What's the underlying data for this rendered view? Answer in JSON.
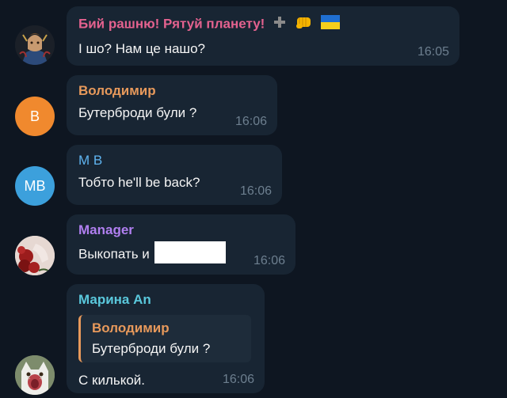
{
  "messages": [
    {
      "sender": "Бий рашню! Рятуй планету!",
      "sender_color": "#e4628f",
      "text": "І шо? Нам це нашо?",
      "time": "16:05",
      "avatar_icon": "warrior-portrait-avatar"
    },
    {
      "sender": "Володимир",
      "sender_color": "#e7995b",
      "text": "Бутерброди були ?",
      "time": "16:06",
      "avatar_initials": "В",
      "avatar_color": "#f0892e"
    },
    {
      "sender": "M B",
      "sender_color": "#5fb4f0",
      "text": "Тобто he'll be back?",
      "time": "16:06",
      "avatar_initials": "MB",
      "avatar_color": "#3ca0dc"
    },
    {
      "sender": "Manager",
      "sender_color": "#b07ff0",
      "text": "Выкопать и",
      "time": "16:06",
      "avatar_icon": "red-roses-avatar"
    },
    {
      "sender": "Марина An",
      "sender_color": "#5ac8dc",
      "reply_to": {
        "sender": "Володимир",
        "text": "Бутерброди були ?"
      },
      "text": "С килькой.",
      "time": "16:06",
      "avatar_icon": "screaming-cat-avatar"
    }
  ],
  "colors": {
    "background": "#0e1621",
    "bubble": "#182533",
    "timestamp": "#6d7f8f",
    "reply_bar": "#e7995b"
  }
}
